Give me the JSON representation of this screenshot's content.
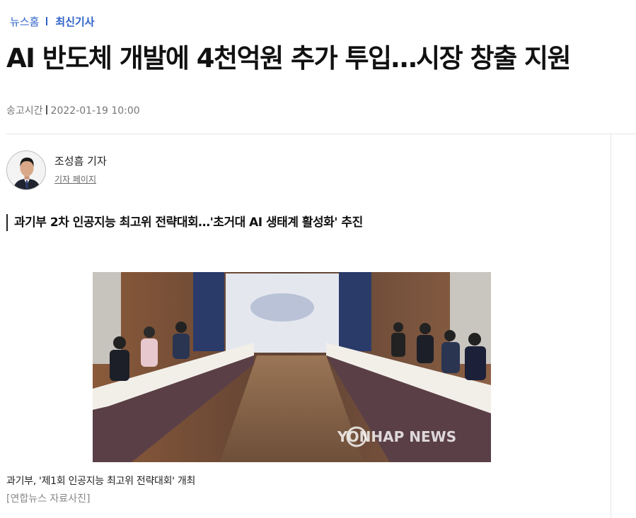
{
  "breadcrumb": {
    "home": "뉴스홈",
    "section": "최신기사"
  },
  "article": {
    "title": "AI 반도체 개발에 4천억원 추가 투입…시장 창출 지원",
    "meta_label": "송고시간",
    "published": "2022-01-19 10:00",
    "subheading": "과기부 2차 인공지능 최고위 전략대회…'초거대 AI 생태계 활성화' 추진"
  },
  "reporter": {
    "name": "조성흠 기자",
    "page_link": "기자 페이지"
  },
  "photo": {
    "watermark": "YONHAP NEWS",
    "caption": "과기부, '제1회 인공지능 최고위 전략대회' 개최",
    "credit": "[연합뉴스 자료사진]"
  },
  "colors": {
    "accent": "#2f62c9",
    "text": "#111111",
    "muted": "#777777",
    "divider": "#e5e5e5"
  }
}
